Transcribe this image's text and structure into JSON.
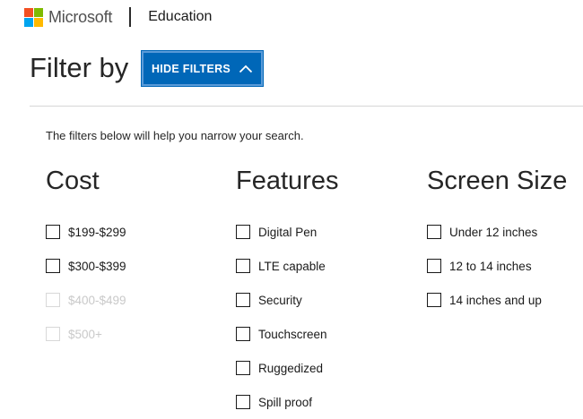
{
  "header": {
    "brand": "Microsoft",
    "section": "Education",
    "logo_colors": [
      "#f25022",
      "#7fba00",
      "#00a4ef",
      "#ffb900"
    ]
  },
  "filter": {
    "title": "Filter by",
    "toggle_button": {
      "label": "HIDE FILTERS",
      "icon": "chevron-up-icon",
      "color": "#0067b8"
    },
    "intro": "The filters below will help you narrow your search."
  },
  "groups": [
    {
      "title": "Cost",
      "options": [
        {
          "label": "$199-$299",
          "checked": false,
          "enabled": true
        },
        {
          "label": "$300-$399",
          "checked": false,
          "enabled": true
        },
        {
          "label": "$400-$499",
          "checked": false,
          "enabled": false
        },
        {
          "label": "$500+",
          "checked": false,
          "enabled": false
        }
      ]
    },
    {
      "title": "Features",
      "options": [
        {
          "label": "Digital Pen",
          "checked": false,
          "enabled": true
        },
        {
          "label": "LTE capable",
          "checked": false,
          "enabled": true
        },
        {
          "label": "Security",
          "checked": false,
          "enabled": true
        },
        {
          "label": "Touchscreen",
          "checked": false,
          "enabled": true
        },
        {
          "label": "Ruggedized",
          "checked": false,
          "enabled": true
        },
        {
          "label": "Spill proof",
          "checked": false,
          "enabled": true
        }
      ]
    },
    {
      "title": "Screen Size",
      "options": [
        {
          "label": "Under 12 inches",
          "checked": false,
          "enabled": true
        },
        {
          "label": "12 to 14 inches",
          "checked": false,
          "enabled": true
        },
        {
          "label": "14 inches and up",
          "checked": false,
          "enabled": true
        }
      ]
    }
  ]
}
